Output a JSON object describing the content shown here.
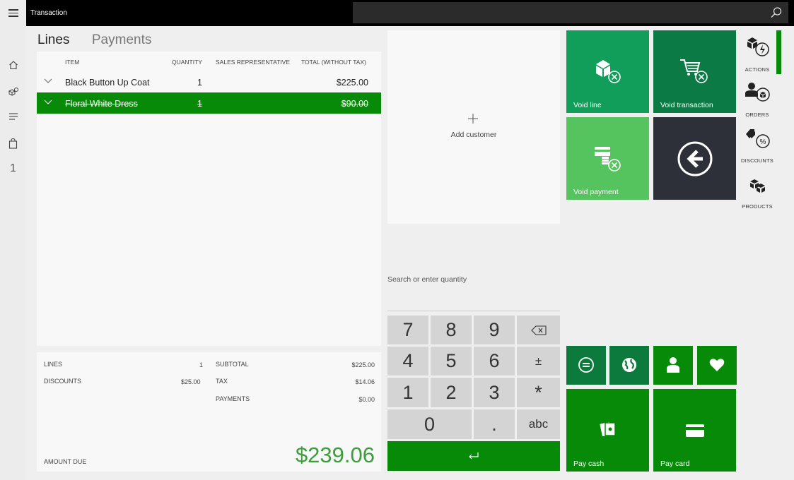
{
  "app": {
    "title": "Transaction"
  },
  "search": {
    "placeholder": ""
  },
  "nav": {
    "cart_count": "1"
  },
  "tabs": [
    {
      "label": "Lines"
    },
    {
      "label": "Payments"
    }
  ],
  "lines": {
    "columns": {
      "item": "ITEM",
      "quantity": "QUANTITY",
      "sales_rep": "SALES REPRESENTATIVE",
      "total": "TOTAL (WITHOUT TAX)"
    },
    "rows": [
      {
        "item": "Black Button Up Coat",
        "quantity": "1",
        "total": "$225.00",
        "selected": false
      },
      {
        "item": "Floral White Dress",
        "quantity": "1",
        "total": "$90.00",
        "selected": true
      }
    ]
  },
  "totals": {
    "lines_label": "LINES",
    "lines_value": "1",
    "discounts_label": "DISCOUNTS",
    "discounts_value": "$25.00",
    "subtotal_label": "SUBTOTAL",
    "subtotal_value": "$225.00",
    "tax_label": "TAX",
    "tax_value": "$14.06",
    "payments_label": "PAYMENTS",
    "payments_value": "$0.00",
    "amount_due_label": "AMOUNT DUE",
    "amount_due_value": "$239.06"
  },
  "customer": {
    "add_label": "Add customer"
  },
  "quantity_input": {
    "placeholder": "Search or enter quantity"
  },
  "numpad": {
    "k7": "7",
    "k8": "8",
    "k9": "9",
    "k4": "4",
    "k5": "5",
    "k6": "6",
    "plusminus": "±",
    "k1": "1",
    "k2": "2",
    "k3": "3",
    "multiply": "*",
    "k0": "0",
    "dot": ".",
    "abc": "abc"
  },
  "tiles": {
    "void_line": "Void line",
    "void_transaction": "Void transaction",
    "void_payment": "Void payment",
    "pay_cash": "Pay cash",
    "pay_card": "Pay card"
  },
  "categories": {
    "actions": "ACTIONS",
    "orders": "ORDERS",
    "discounts": "DISCOUNTS",
    "products": "PRODUCTS"
  },
  "colors": {
    "brand_green": "#078a07",
    "tile_green_1": "#109e5a",
    "tile_green_2": "#0b7a45",
    "tile_light_green": "#55c45e",
    "tile_dark": "#2d3038"
  }
}
